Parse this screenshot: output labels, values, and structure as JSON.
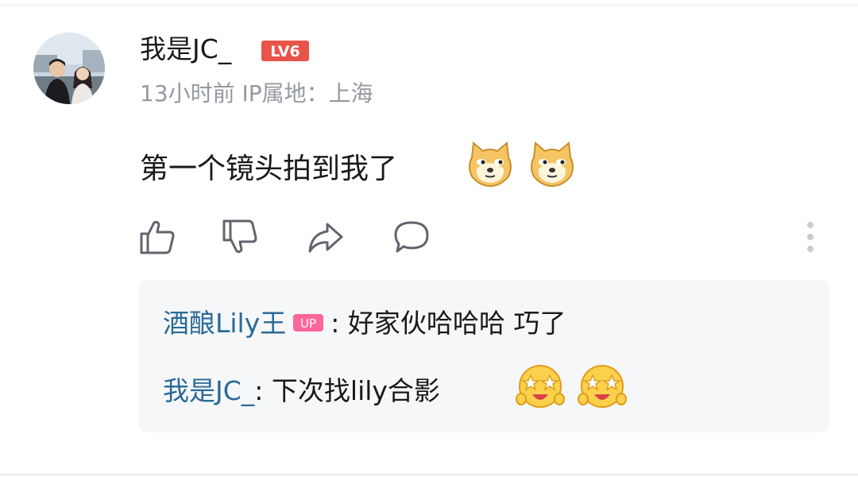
{
  "comment": {
    "username": "我是JC_",
    "level_label": "LV6",
    "meta": "13小时前 IP属地：上海",
    "text": "第一个镜头拍到我了",
    "emoji_names": [
      "doge-emoji",
      "doge-emoji"
    ]
  },
  "actions": [
    "like-icon",
    "dislike-icon",
    "share-icon",
    "reply-icon",
    "more-icon"
  ],
  "replies": [
    {
      "author": "酒酿Lily王",
      "badge": "UP",
      "separator": ":",
      "text": " 好家伙哈哈哈 巧了"
    },
    {
      "author": "我是JC_",
      "separator": ":",
      "text": " 下次找lily合影",
      "emoji_names": [
        "starry-eyes-emoji",
        "starry-eyes-emoji"
      ]
    }
  ],
  "colors": {
    "author_link": "#2a6a98",
    "level_badge": "#e8544a",
    "up_badge": "#ff6699",
    "meta_gray": "#9499a0",
    "reply_bg": "#f6f7f8"
  }
}
